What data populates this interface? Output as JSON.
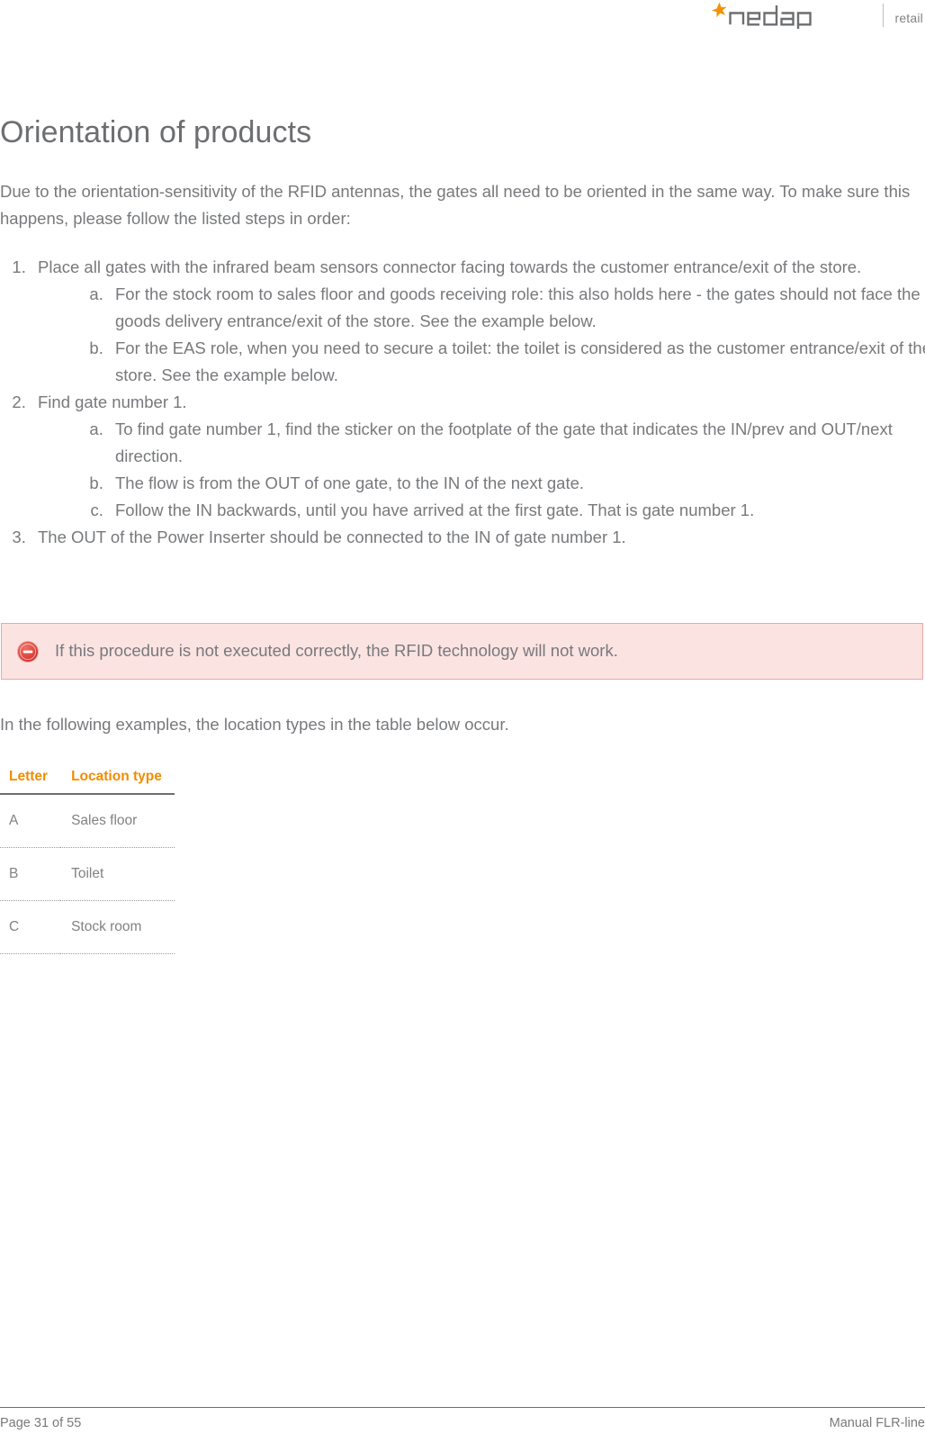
{
  "header": {
    "logo_name": "nedap",
    "logo_sub": "retail",
    "brand_orange": "#F39200",
    "brand_gray": "#6d6e71"
  },
  "main": {
    "title": "Orientation of products",
    "intro": "Due to the orientation-sensitivity of the RFID antennas, the gates all need to be oriented in the same way. To make sure this happens, please follow the listed steps in order:",
    "steps": [
      {
        "text": "Place all gates with the infrared beam sensors connector facing towards the customer entrance/exit of the store.",
        "substeps": [
          "For the stock room to sales floor and goods receiving role: this also holds here - the gates should not face the goods delivery entrance/exit of the store. See the example below.",
          "For the EAS role, when you need to secure a toilet: the toilet is considered as the customer entrance/exit of the store. See the example below."
        ]
      },
      {
        "text": "Find gate number 1.",
        "substeps": [
          "To find gate number 1, find the sticker on the footplate of the gate that indicates the IN/prev and OUT/next direction.",
          "The flow is from the OUT of one gate, to the IN of the next gate.",
          "Follow the IN backwards, until you have arrived at the first gate. That is gate number 1."
        ]
      },
      {
        "text": "The OUT of the Power Inserter should be connected to the IN of gate number 1.",
        "substeps": []
      }
    ],
    "alert": {
      "icon": "no-entry-icon",
      "text": "If this procedure is not executed correctly, the RFID technology will not work.",
      "background": "#fbe3e2",
      "border_color": "#e9a9a5",
      "icon_color": "#d9322a"
    },
    "examples_paragraph": "In the following examples, the location types in the table below occur.",
    "table": {
      "headers": [
        "Letter",
        "Location type"
      ],
      "rows": [
        [
          "A",
          "Sales floor"
        ],
        [
          "B",
          "Toilet"
        ],
        [
          "C",
          "Stock room"
        ]
      ]
    }
  },
  "footer": {
    "page_label": "Page 31 of 55",
    "document_label": "Manual FLR-line"
  }
}
